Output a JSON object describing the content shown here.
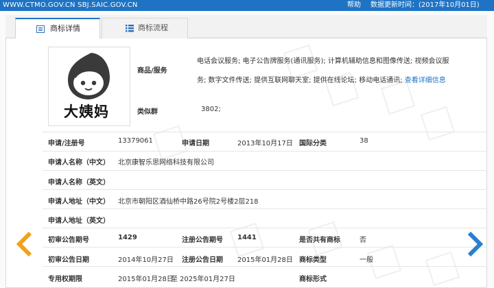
{
  "topbar": {
    "site": "WWW.CTMO.GOV.CN SBJ.SAIC.GOV.CN",
    "help": "帮助",
    "update": "数据更新时间：(2017年10月01日)"
  },
  "tabs": [
    {
      "label": "商标详情",
      "icon": "document-icon",
      "active": true
    },
    {
      "label": "商标流程",
      "icon": "list-icon",
      "active": false
    }
  ],
  "logo": {
    "text": "大姨妈"
  },
  "goods": {
    "label": "商品/服务",
    "text": "电话会议服务; 电子公告牌服务(通讯服务); 计算机辅助信息和图像传送; 视频会议服务; 数字文件传送; 提供互联网聊天室; 提供在线论坛; 移动电话通讯;",
    "link": "查看详细信息"
  },
  "similar_group": {
    "label": "类似群",
    "value": "3802;"
  },
  "fields": {
    "reg_no_label": "申请/注册号",
    "reg_no": "13379061",
    "app_date_label": "申请日期",
    "app_date": "2013年10月17日",
    "intl_class_label": "国际分类",
    "intl_class": "38",
    "applicant_cn_label": "申请人名称（中文）",
    "applicant_cn": "北京康智乐思网络科技有限公司",
    "applicant_en_label": "申请人名称（英文）",
    "applicant_en": "",
    "address_cn_label": "申请人地址（中文）",
    "address_cn": "北京市朝阳区酒仙桥中路26号院2号楼2层218",
    "address_en_label": "申请人地址（英文）",
    "address_en": "",
    "prelim_no_label": "初审公告期号",
    "prelim_no": "1429",
    "reg_pub_no_label": "注册公告期号",
    "reg_pub_no": "1441",
    "shared_label": "是否共有商标",
    "shared": "否",
    "prelim_date_label": "初审公告日期",
    "prelim_date": "2014年10月27日",
    "reg_pub_date_label": "注册公告日期",
    "reg_pub_date": "2015年01月28日",
    "tm_type_label": "商标类型",
    "tm_type": "一般",
    "exclusive_label": "专用权期限",
    "exclusive_start": "2015年01月28日",
    "exclusive_to": "至",
    "exclusive_end": "2025年01月27日",
    "tm_form_label": "商标形式",
    "tm_form": ""
  },
  "colors": {
    "topbar": "#1e73c4",
    "arrow_left": "#f0a21a",
    "arrow_right": "#2b7fd0",
    "link": "#1e73c4"
  }
}
